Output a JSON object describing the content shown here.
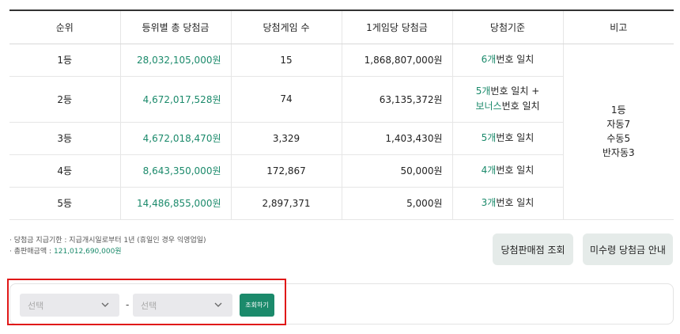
{
  "table": {
    "headers": [
      "순위",
      "등위별 총 당첨금",
      "당첨게임 수",
      "1게임당 당첨금",
      "당첨기준",
      "비고"
    ],
    "rows": [
      {
        "rank": "1등",
        "total": "28,032,105,000원",
        "games": "15",
        "per_game": "1,868,807,000원",
        "crit_a_hl": "6개",
        "crit_a": "번호 일치",
        "crit_b_hl": "",
        "crit_b": ""
      },
      {
        "rank": "2등",
        "total": "4,672,017,528원",
        "games": "74",
        "per_game": "63,135,372원",
        "crit_a_hl": "5개",
        "crit_a": "번호 일치 +",
        "crit_b_hl": "보너스",
        "crit_b": "번호 일치"
      },
      {
        "rank": "3등",
        "total": "4,672,018,470원",
        "games": "3,329",
        "per_game": "1,403,430원",
        "crit_a_hl": "5개",
        "crit_a": "번호 일치",
        "crit_b_hl": "",
        "crit_b": ""
      },
      {
        "rank": "4등",
        "total": "8,643,350,000원",
        "games": "172,867",
        "per_game": "50,000원",
        "crit_a_hl": "4개",
        "crit_a": "번호 일치",
        "crit_b_hl": "",
        "crit_b": ""
      },
      {
        "rank": "5등",
        "total": "14,486,855,000원",
        "games": "2,897,371",
        "per_game": "5,000원",
        "crit_a_hl": "3개",
        "crit_a": "번호 일치",
        "crit_b_hl": "",
        "crit_b": ""
      }
    ],
    "note_lines": [
      "1등",
      "자동7",
      "수동5",
      "반자동3"
    ]
  },
  "info": {
    "deadline": "· 당첨금 지급기한 : 지급개시일로부터 1년 (휴일인 경우 익영업일)",
    "sales_label": "· 총판매금액 :",
    "sales_value": "121,012,690,000원"
  },
  "buttons": {
    "store_lookup": "당첨판매점 조회",
    "unclaimed_info": "미수령 당첨금 안내"
  },
  "filter": {
    "select_from": "선택",
    "select_to": "선택",
    "separator": "-",
    "search_label": "조회하기"
  },
  "colors": {
    "accent": "#1b8a6b",
    "highlight_border": "#e01818",
    "button_gray": "#e5ebe9"
  }
}
